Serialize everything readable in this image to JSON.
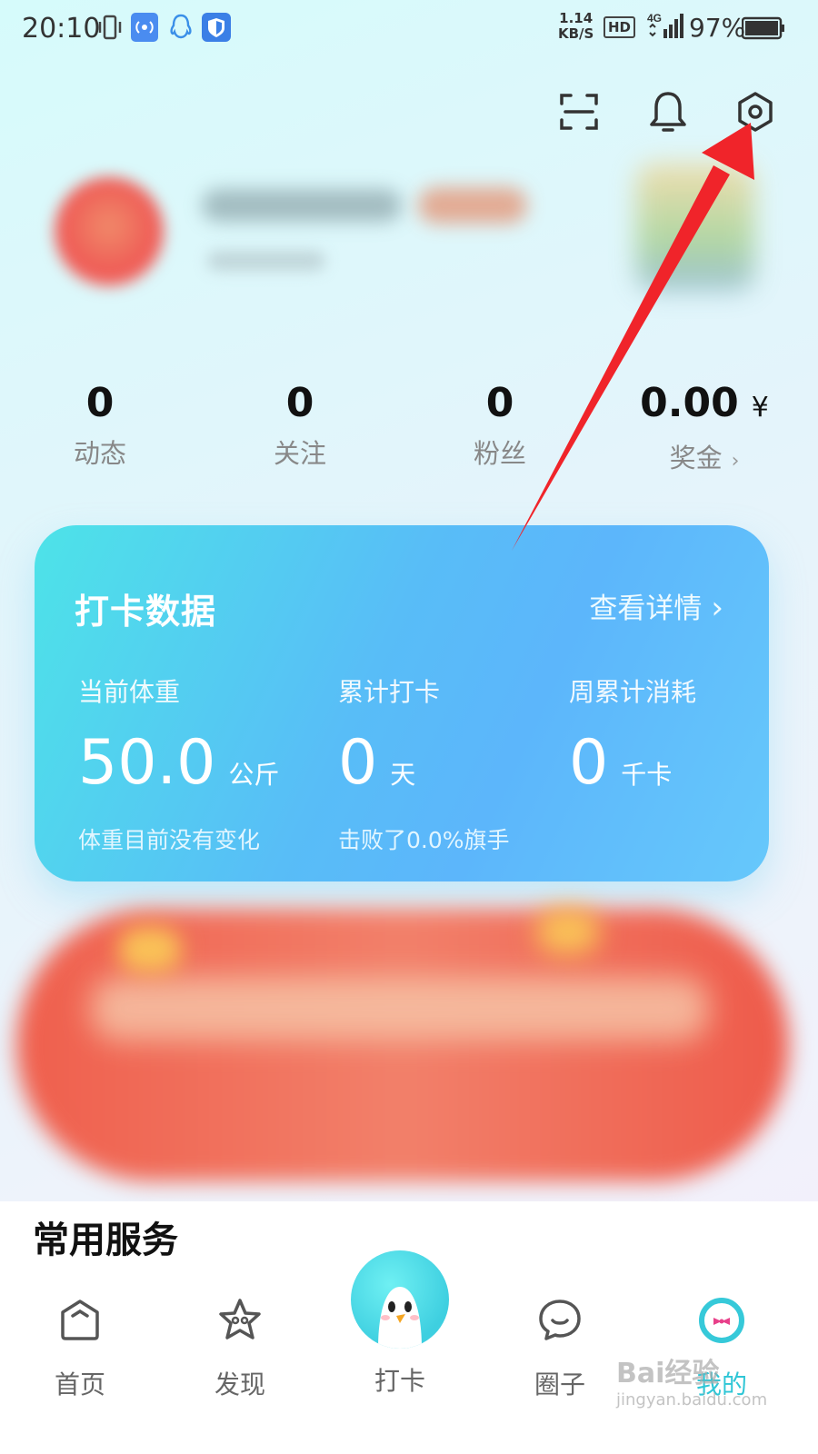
{
  "status_bar": {
    "time": "20:10",
    "speed_value": "1.14",
    "speed_unit": "KB/S",
    "hd": "HD",
    "network": "4G",
    "battery": "97%"
  },
  "top_actions": {
    "icons": [
      "scan-icon",
      "bell-icon",
      "gear-icon"
    ]
  },
  "stats": [
    {
      "value": "0",
      "label": "动态"
    },
    {
      "value": "0",
      "label": "关注"
    },
    {
      "value": "0",
      "label": "粉丝"
    },
    {
      "value": "0.00",
      "currency": "¥",
      "label": "奖金",
      "chevron": "›"
    }
  ],
  "checkin_card": {
    "title": "打卡数据",
    "detail_link": "查看详情",
    "detail_arrow": "›",
    "metrics": [
      {
        "label": "当前体重",
        "value": "50.0",
        "unit": "公斤",
        "note": "体重目前没有变化"
      },
      {
        "label": "累计打卡",
        "value": "0",
        "unit": "天",
        "note": "击败了0.0%旗手"
      },
      {
        "label": "周累计消耗",
        "value": "0",
        "unit": "千卡",
        "note": ""
      }
    ]
  },
  "services": {
    "title": "常用服务"
  },
  "bottom_nav": {
    "items": [
      {
        "label": "首页",
        "icon": "home-icon"
      },
      {
        "label": "发现",
        "icon": "star-icon"
      },
      {
        "label": "打卡",
        "icon": "penguin-icon"
      },
      {
        "label": "圈子",
        "icon": "chat-icon"
      },
      {
        "label": "我的",
        "icon": "profile-ring-icon"
      }
    ]
  },
  "watermark": {
    "brand": "Bai经验",
    "url": "jingyan.baidu.com"
  },
  "colors": {
    "accent": "#2fc6d6",
    "card_start": "#4de3e8",
    "card_end": "#5cb6fb",
    "arrow_red": "#f0242a"
  }
}
